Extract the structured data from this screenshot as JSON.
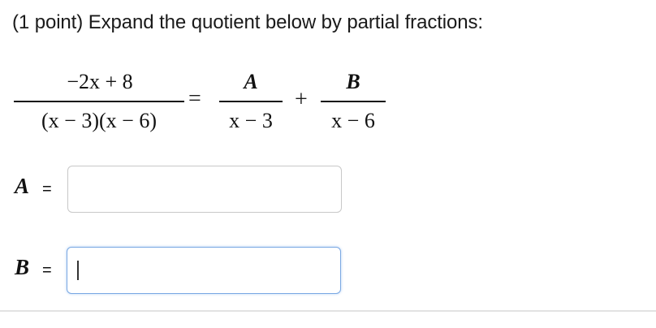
{
  "question": {
    "prompt": "(1 point) Expand the quotient below by partial fractions:"
  },
  "equation": {
    "lhs_numerator": "−2x + 8",
    "lhs_denominator": "(x − 3)(x − 6)",
    "equals": "=",
    "plus": "+",
    "term1_numerator": "A",
    "term1_denominator": "x − 3",
    "term2_numerator": "B",
    "term2_denominator": "x − 6"
  },
  "answers": [
    {
      "label": "A",
      "equals": "=",
      "value": "",
      "placeholder": "",
      "focused": false
    },
    {
      "label": "B",
      "equals": "=",
      "value": "",
      "placeholder": "",
      "focused": true
    }
  ],
  "colors": {
    "input_border": "#c8c8c8",
    "input_focus_border": "#7aa8e3",
    "divider": "#e2e2e2"
  }
}
